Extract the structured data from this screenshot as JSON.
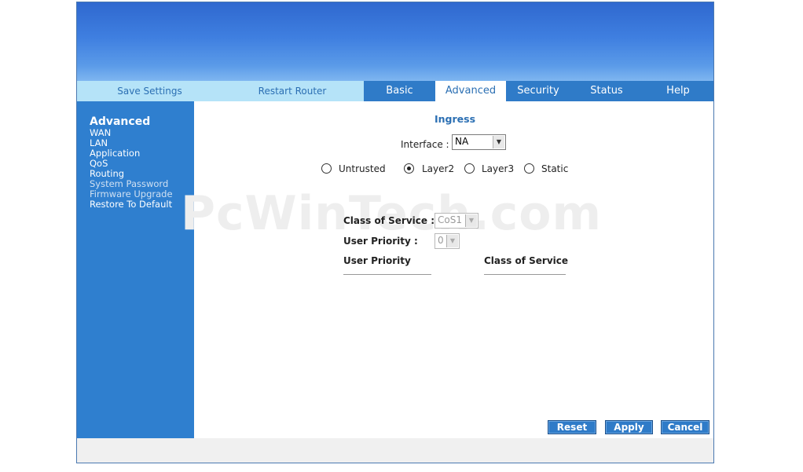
{
  "top_links": {
    "save_settings": "Save Settings",
    "restart_router": "Restart Router"
  },
  "tabs": [
    "Basic",
    "Advanced",
    "Security",
    "Status",
    "Help"
  ],
  "active_tab": "Advanced",
  "sidebar": {
    "heading": "Advanced",
    "items": [
      "WAN",
      "LAN",
      "Application",
      "QoS",
      "Routing",
      "System Password",
      "Firmware Upgrade",
      "Restore To Default"
    ]
  },
  "content": {
    "section_title": "Ingress",
    "interface_label": "Interface :",
    "interface_value": "NA",
    "radios": [
      {
        "label": "Untrusted",
        "checked": false
      },
      {
        "label": "Layer2",
        "checked": true
      },
      {
        "label": "Layer3",
        "checked": false
      },
      {
        "label": "Static",
        "checked": false
      }
    ],
    "class_of_service_label": "Class of Service :",
    "class_of_service_value": "CoS1",
    "user_priority_label": "User Priority :",
    "user_priority_value": "0",
    "table_headers": [
      "User Priority",
      "Class of Service"
    ]
  },
  "buttons": {
    "reset": "Reset",
    "apply": "Apply",
    "cancel": "Cancel"
  },
  "watermark": "PcWinTech.com",
  "colors": {
    "accent": "#2f7bc8",
    "topbar": "#b5e3f8",
    "sidebar": "#2f7fcf",
    "title": "#2b6fb3"
  }
}
